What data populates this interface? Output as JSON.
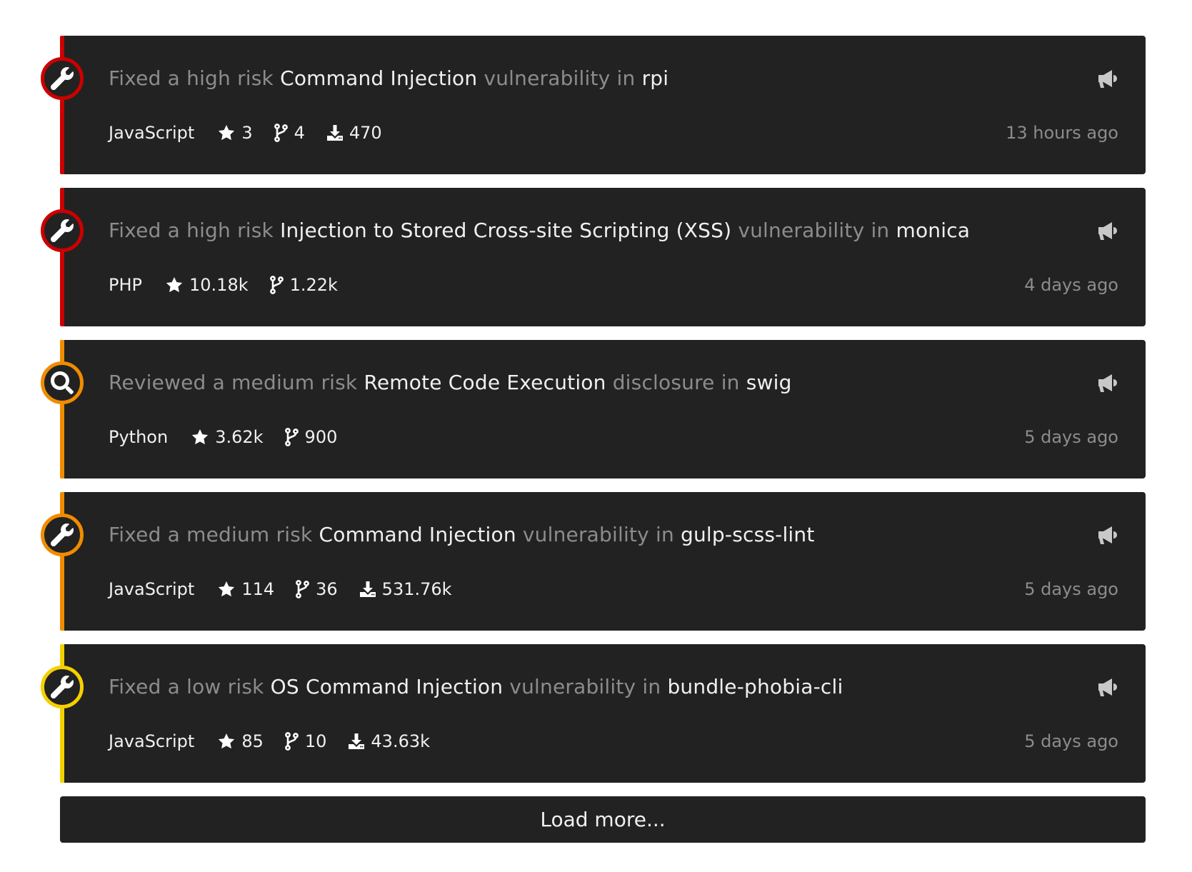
{
  "colors": {
    "high": "#cc0000",
    "medium": "#f08c00",
    "low": "#f5d000"
  },
  "items": [
    {
      "action": "Fixed a",
      "risk": "high risk",
      "risk_level": "high",
      "icon": "wrench-icon",
      "title": "Command Injection",
      "kind": "vulnerability in",
      "package": "rpi",
      "language": "JavaScript",
      "stars": "3",
      "forks": "4",
      "downloads": "470",
      "time": "13 hours ago"
    },
    {
      "action": "Fixed a",
      "risk": "high risk",
      "risk_level": "high",
      "icon": "wrench-icon",
      "title": "Injection to Stored Cross-site Scripting (XSS)",
      "kind": "vulnerability in",
      "package": "monica",
      "language": "PHP",
      "stars": "10.18k",
      "forks": "1.22k",
      "downloads": null,
      "time": "4 days ago"
    },
    {
      "action": "Reviewed a",
      "risk": "medium risk",
      "risk_level": "medium",
      "icon": "search-icon",
      "title": "Remote Code Execution",
      "kind": "disclosure in",
      "package": "swig",
      "language": "Python",
      "stars": "3.62k",
      "forks": "900",
      "downloads": null,
      "time": "5 days ago"
    },
    {
      "action": "Fixed a",
      "risk": "medium risk",
      "risk_level": "medium",
      "icon": "wrench-icon",
      "title": "Command Injection",
      "kind": "vulnerability in",
      "package": "gulp-scss-lint",
      "language": "JavaScript",
      "stars": "114",
      "forks": "36",
      "downloads": "531.76k",
      "time": "5 days ago"
    },
    {
      "action": "Fixed a",
      "risk": "low risk",
      "risk_level": "low",
      "icon": "wrench-icon",
      "title": "OS Command Injection",
      "kind": "vulnerability in",
      "package": "bundle-phobia-cli",
      "language": "JavaScript",
      "stars": "85",
      "forks": "10",
      "downloads": "43.63k",
      "time": "5 days ago"
    }
  ],
  "load_more_label": "Load more..."
}
